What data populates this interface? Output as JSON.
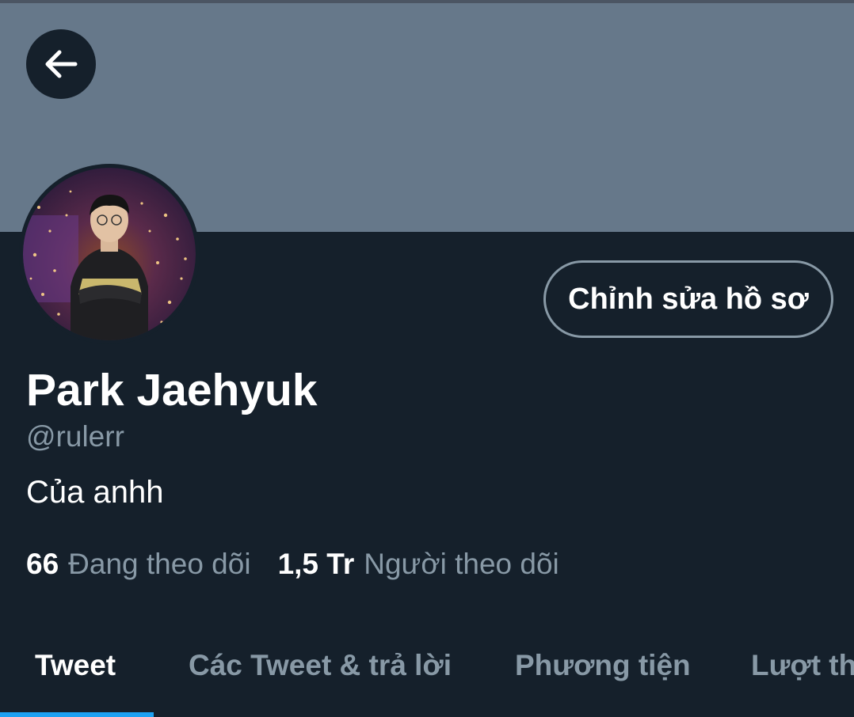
{
  "header": {
    "back_icon": "arrow-left-icon",
    "banner_color": "#66788a"
  },
  "profile": {
    "avatar_icon": "profile-photo",
    "edit_button_label": "Chỉnh sửa hồ sơ",
    "display_name": "Park Jaehyuk",
    "handle": "@rulerr",
    "bio": "Của anhh"
  },
  "stats": {
    "following_count": "66",
    "following_label": "Đang theo dõi",
    "followers_count": "1,5 Tr",
    "followers_label": "Người theo dõi"
  },
  "tabs": [
    {
      "label": "Tweet",
      "active": true
    },
    {
      "label": "Các Tweet & trả lời",
      "active": false
    },
    {
      "label": "Phương tiện",
      "active": false
    },
    {
      "label": "Lượt thích",
      "active": false
    }
  ],
  "colors": {
    "background": "#15202b",
    "secondary_text": "#8899a6",
    "accent": "#1da1f2"
  }
}
